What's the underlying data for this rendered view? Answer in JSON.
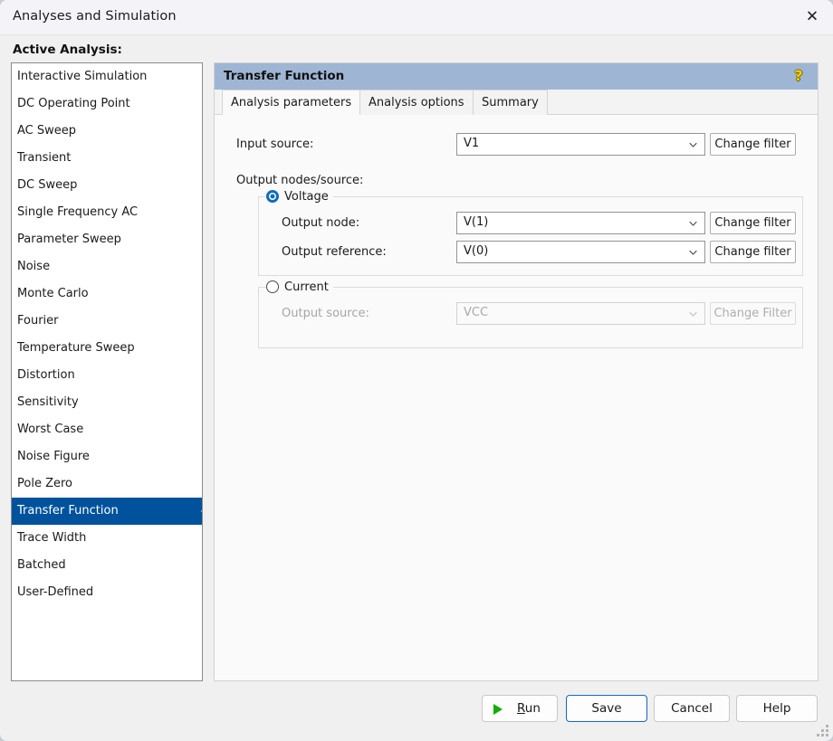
{
  "window": {
    "title": "Analyses and Simulation",
    "close_icon": "close-icon"
  },
  "sidebar": {
    "label": "Active Analysis:",
    "items": [
      {
        "label": "Interactive Simulation",
        "selected": false
      },
      {
        "label": "DC Operating Point",
        "selected": false
      },
      {
        "label": "AC Sweep",
        "selected": false
      },
      {
        "label": "Transient",
        "selected": false
      },
      {
        "label": "DC Sweep",
        "selected": false
      },
      {
        "label": "Single Frequency AC",
        "selected": false
      },
      {
        "label": "Parameter Sweep",
        "selected": false
      },
      {
        "label": "Noise",
        "selected": false
      },
      {
        "label": "Monte Carlo",
        "selected": false
      },
      {
        "label": "Fourier",
        "selected": false
      },
      {
        "label": "Temperature Sweep",
        "selected": false
      },
      {
        "label": "Distortion",
        "selected": false
      },
      {
        "label": "Sensitivity",
        "selected": false
      },
      {
        "label": "Worst Case",
        "selected": false
      },
      {
        "label": "Noise Figure",
        "selected": false
      },
      {
        "label": "Pole Zero",
        "selected": false
      },
      {
        "label": "Transfer Function",
        "selected": true
      },
      {
        "label": "Trace Width",
        "selected": false
      },
      {
        "label": "Batched",
        "selected": false
      },
      {
        "label": "User-Defined",
        "selected": false
      }
    ]
  },
  "panel": {
    "header_title": "Transfer Function",
    "help_icon": "help-question-icon",
    "tabs": [
      {
        "label": "Analysis parameters",
        "active": true
      },
      {
        "label": "Analysis options",
        "active": false
      },
      {
        "label": "Summary",
        "active": false
      }
    ]
  },
  "form": {
    "input_source_label": "Input source:",
    "input_source_value": "V1",
    "input_source_change_filter": "Change filter",
    "output_nodes_label": "Output nodes/source:",
    "voltage": {
      "legend": "Voltage",
      "selected": true,
      "output_node_label": "Output node:",
      "output_node_value": "V(1)",
      "output_node_change_filter": "Change filter",
      "output_reference_label": "Output reference:",
      "output_reference_value": "V(0)",
      "output_reference_change_filter": "Change filter"
    },
    "current": {
      "legend": "Current",
      "selected": false,
      "output_source_label": "Output source:",
      "output_source_value": "VCC",
      "output_source_change_filter": "Change Filter"
    }
  },
  "footer": {
    "run_label_prefix": "R",
    "run_label_rest": "un",
    "save_label": "Save",
    "cancel_label": "Cancel",
    "help_label": "Help"
  },
  "colors": {
    "selection_blue": "#00529c",
    "header_blue": "#9eb6d4",
    "accent_blue": "#0f6cbd",
    "run_green": "#0fb000",
    "help_yellow": "#f5d000"
  }
}
